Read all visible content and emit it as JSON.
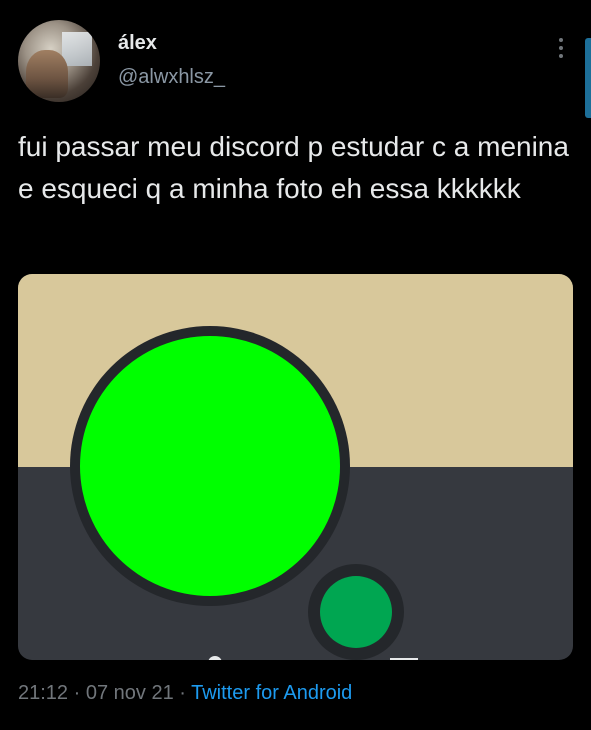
{
  "author": {
    "display_name": "álex",
    "handle": "@alwxhlsz_"
  },
  "tweet": {
    "text": "fui passar meu discord p estudar c a menina e esqueci q a minha foto eh essa kkkkkk"
  },
  "media": {
    "banner_color": "#d8c89b",
    "background_color": "#36393f",
    "avatar_color": "#00ff00",
    "status_color": "#00a651"
  },
  "meta": {
    "time": "21:12",
    "separator1": " · ",
    "date": "07 nov 21",
    "separator2": " · ",
    "source": "Twitter for Android"
  },
  "icons": {
    "more": "vertical-dots-icon"
  }
}
